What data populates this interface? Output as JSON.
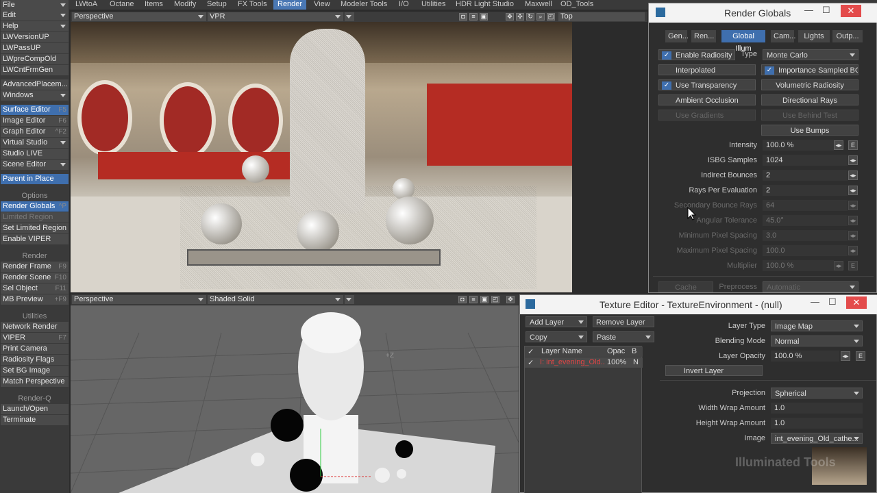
{
  "menu_tabs": [
    "File",
    "LWtoA",
    "Octane",
    "Items",
    "Modify",
    "Setup",
    "FX Tools",
    "Render",
    "View",
    "Modeler Tools",
    "I/O",
    "Utilities",
    "HDR Light Studio",
    "Maxwell",
    "OD_Tools"
  ],
  "left_toolbar": {
    "top_dropdowns": [
      "File",
      "Edit",
      "Help"
    ],
    "plugins": [
      "LWVersionUP",
      "LWPassUP",
      "LWpreCompOld",
      "LWCntFrmGen"
    ],
    "advanced": "AdvancedPlacem...",
    "windows": "Windows",
    "editors": [
      {
        "label": "Surface Editor",
        "shortcut": "F5"
      },
      {
        "label": "Image Editor",
        "shortcut": "F6"
      },
      {
        "label": "Graph Editor",
        "shortcut": "^F2"
      },
      {
        "label": "Virtual Studio",
        "shortcut": ""
      },
      {
        "label": "Studio LIVE",
        "shortcut": ""
      },
      {
        "label": "Scene Editor",
        "shortcut": ""
      }
    ],
    "parent_in_place": "Parent in Place",
    "options_header": "Options",
    "options": [
      {
        "label": "Render Globals",
        "shortcut": "^P"
      },
      {
        "label": "Limited Region",
        "shortcut": ""
      },
      {
        "label": "Set Limited Region",
        "shortcut": ""
      },
      {
        "label": "Enable VIPER",
        "shortcut": ""
      }
    ],
    "render_header": "Render",
    "render": [
      {
        "label": "Render Frame",
        "shortcut": "F9"
      },
      {
        "label": "Render Scene",
        "shortcut": "F10"
      },
      {
        "label": "Sel Object",
        "shortcut": "F11"
      },
      {
        "label": "MB Preview",
        "shortcut": "+F9"
      }
    ],
    "utilities_header": "Utilities",
    "utilities": [
      {
        "label": "Network Render",
        "shortcut": ""
      },
      {
        "label": "VIPER",
        "shortcut": "F7"
      },
      {
        "label": "Print Camera",
        "shortcut": ""
      },
      {
        "label": "Radiosity Flags",
        "shortcut": ""
      },
      {
        "label": "Set BG Image",
        "shortcut": ""
      },
      {
        "label": "Match Perspective",
        "shortcut": ""
      }
    ],
    "renderq_header": "Render-Q",
    "renderq": [
      {
        "label": "Launch/Open",
        "shortcut": ""
      },
      {
        "label": "Terminate",
        "shortcut": ""
      }
    ]
  },
  "viewport_top": {
    "view": "Perspective",
    "mode": "VPR",
    "right_view": "Top"
  },
  "viewport_bottom": {
    "view": "Perspective",
    "mode": "Shaded Solid",
    "axis_label": "+Z"
  },
  "render_globals": {
    "title": "Render Globals",
    "tabs": [
      "Gen...",
      "Ren...",
      "Global Illum",
      "Cam...",
      "Lights",
      "Outp..."
    ],
    "enable_radiosity": "Enable Radiosity",
    "type_label": "Type",
    "type_value": "Monte Carlo",
    "interpolated": "Interpolated",
    "importance_sampled_bg": "Importance Sampled BG",
    "use_transparency": "Use Transparency",
    "volumetric_radiosity": "Volumetric Radiosity",
    "ambient_occlusion": "Ambient Occlusion",
    "directional_rays": "Directional Rays",
    "use_gradients": "Use Gradients",
    "use_behind_test": "Use Behind Test",
    "use_bumps": "Use Bumps",
    "params": [
      {
        "label": "Intensity",
        "value": "100.0 %",
        "enabled": true
      },
      {
        "label": "ISBG Samples",
        "value": "1024",
        "enabled": true
      },
      {
        "label": "Indirect Bounces",
        "value": "2",
        "enabled": true
      },
      {
        "label": "Rays Per Evaluation",
        "value": "2",
        "enabled": true
      },
      {
        "label": "Secondary Bounce Rays",
        "value": "64",
        "enabled": false
      },
      {
        "label": "Angular Tolerance",
        "value": "45.0°",
        "enabled": false
      },
      {
        "label": "Minimum Pixel Spacing",
        "value": "3.0",
        "enabled": false
      },
      {
        "label": "Maximum Pixel Spacing",
        "value": "100.0",
        "enabled": false
      },
      {
        "label": "Multiplier",
        "value": "100.0 %",
        "enabled": false
      }
    ],
    "cache": "Cache",
    "preprocess_label": "Preprocess",
    "preprocess_value": "Automatic",
    "e_label": "E"
  },
  "texture_editor": {
    "title": "Texture Editor - TextureEnvironment - (null)",
    "add_layer": "Add Layer",
    "remove_layer": "Remove Layer",
    "copy": "Copy",
    "paste": "Paste",
    "col_name": "Layer Name",
    "col_opac": "Opac",
    "col_b": "B",
    "layer_name": "I: int_evening_Old...",
    "layer_opac": "100%",
    "layer_b": "N",
    "layer_type_label": "Layer Type",
    "layer_type_value": "Image Map",
    "blending_label": "Blending Mode",
    "blending_value": "Normal",
    "opacity_label": "Layer Opacity",
    "opacity_value": "100.0 %",
    "invert_layer": "Invert Layer",
    "projection_label": "Projection",
    "projection_value": "Spherical",
    "width_wrap_label": "Width Wrap Amount",
    "width_wrap_value": "1.0",
    "height_wrap_label": "Height Wrap Amount",
    "height_wrap_value": "1.0",
    "image_label": "Image",
    "image_value": "int_evening_Old_cathe..."
  },
  "watermark": "Illuminated Tools",
  "colors": {
    "accent": "#3f6fae",
    "close": "#e34b4b"
  }
}
